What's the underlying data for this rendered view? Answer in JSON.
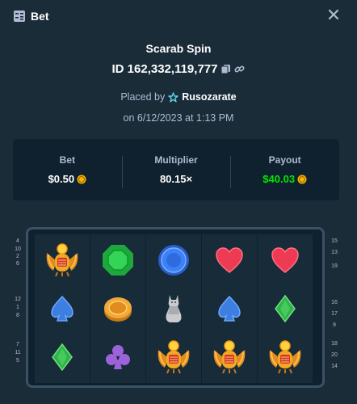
{
  "header": {
    "title": "Bet"
  },
  "game": {
    "name": "Scarab Spin"
  },
  "bet": {
    "id_text": "ID 162,332,119,777",
    "placed_by_label": "Placed by",
    "username": "Rusozarate",
    "date_text": "on 6/12/2023 at 1:13 PM"
  },
  "stats": {
    "bet_label": "Bet",
    "bet_value": "$0.50",
    "multiplier_label": "Multiplier",
    "multiplier_value": "80.15×",
    "payout_label": "Payout",
    "payout_value": "$40.03"
  },
  "reels": [
    [
      "scarab",
      "spade",
      "diamond"
    ],
    [
      "emerald",
      "coin",
      "club"
    ],
    [
      "sapphire",
      "cat-statue",
      "scarab"
    ],
    [
      "heart",
      "spade",
      "scarab"
    ],
    [
      "heart",
      "diamond",
      "scarab"
    ]
  ],
  "paylines": {
    "left": [
      "4",
      "10",
      "2",
      "6",
      "12",
      "1",
      "8",
      "7",
      "11",
      "5"
    ],
    "right": [
      "15",
      "13",
      "19",
      "16",
      "17",
      "9",
      "18",
      "20",
      "14"
    ]
  },
  "colors": {
    "background": "#1a2c38",
    "panel": "#0f212e",
    "muted_text": "#b1bad3",
    "payout_green": "#00e701",
    "coin_gold": "#f5b400"
  }
}
